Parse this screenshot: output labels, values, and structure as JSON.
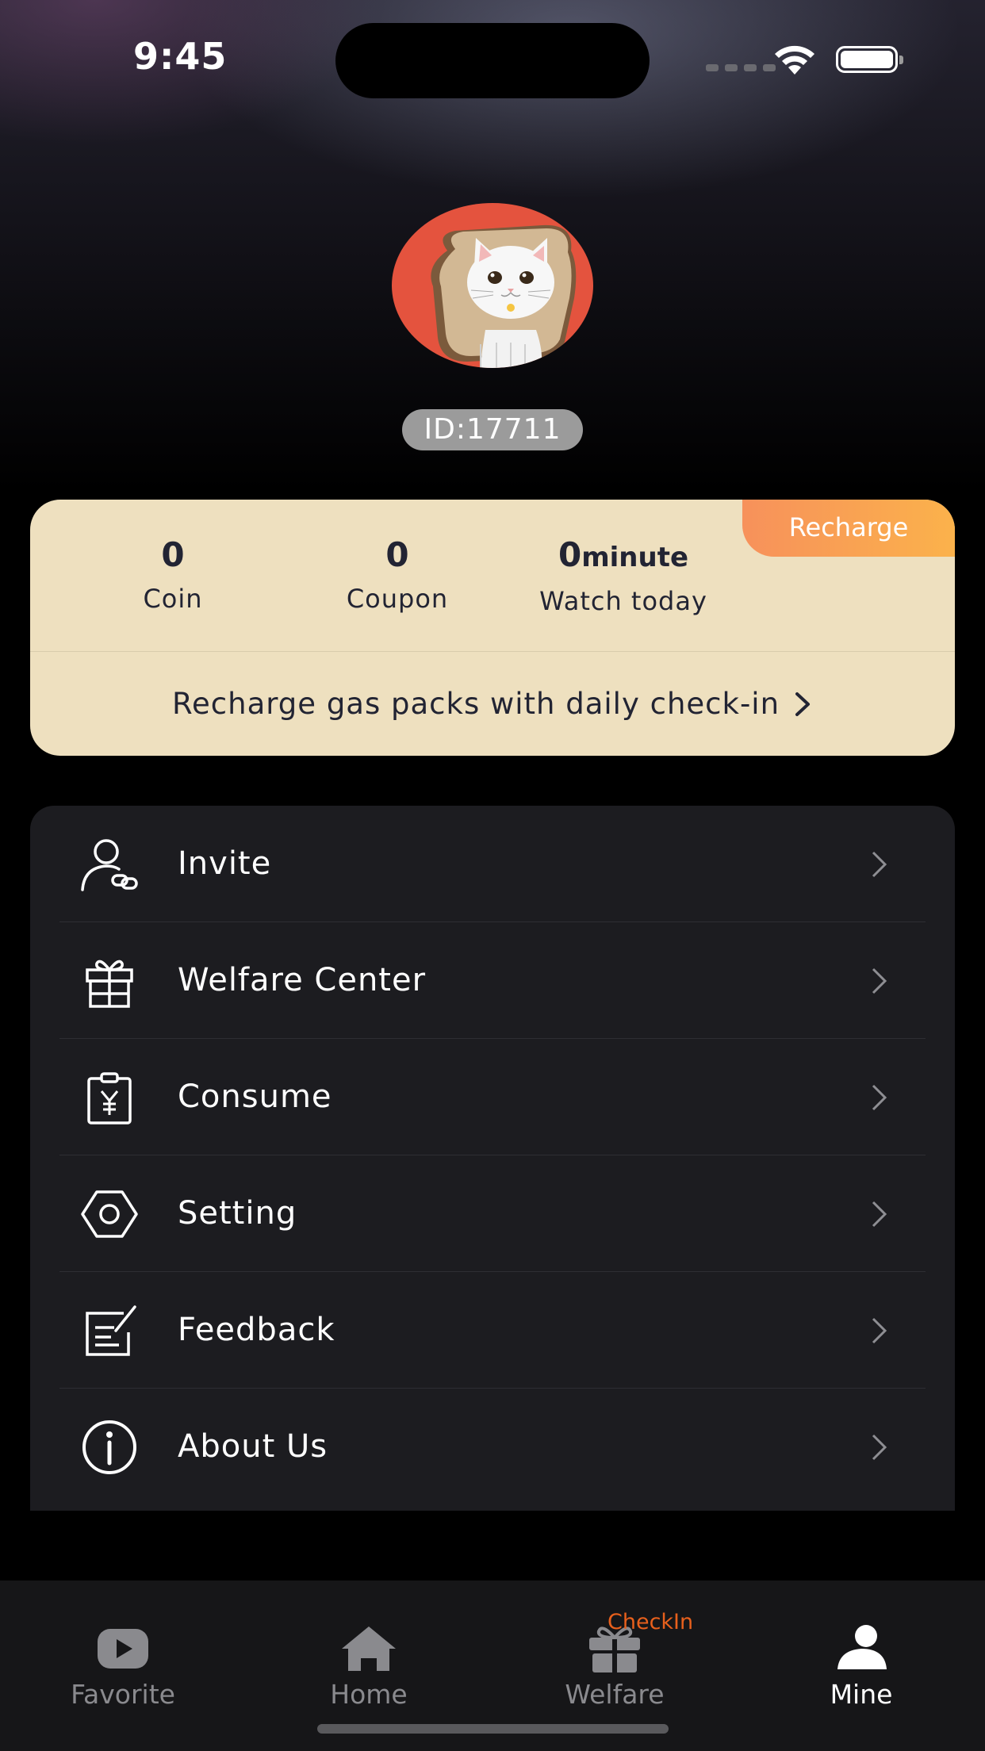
{
  "status_bar": {
    "time": "9:45"
  },
  "profile": {
    "id_label": "ID:17711"
  },
  "stats_card": {
    "recharge_label": "Recharge",
    "coin": {
      "value": "0",
      "label": "Coin"
    },
    "coupon": {
      "value": "0",
      "label": "Coupon"
    },
    "watch": {
      "value": "0",
      "unit": "minute",
      "label": "Watch today"
    },
    "checkin_text": "Recharge gas packs with daily check-in"
  },
  "menu": {
    "items": [
      {
        "label": "Invite",
        "icon": "invite-icon"
      },
      {
        "label": "Welfare Center",
        "icon": "gift-icon"
      },
      {
        "label": "Consume",
        "icon": "yen-receipt-icon"
      },
      {
        "label": "Setting",
        "icon": "gear-icon"
      },
      {
        "label": "Feedback",
        "icon": "edit-note-icon"
      },
      {
        "label": "About Us",
        "icon": "info-icon"
      }
    ]
  },
  "tabbar": {
    "tabs": [
      {
        "label": "Favorite",
        "icon": "play-icon"
      },
      {
        "label": "Home",
        "icon": "home-icon"
      },
      {
        "label": "Welfare",
        "icon": "gift-icon"
      },
      {
        "label": "Mine",
        "icon": "person-icon"
      }
    ],
    "active_tab": "Mine",
    "checkin_badge": "CheckIn"
  },
  "colors": {
    "card_bg": "#eee0bf",
    "recharge_gradient_start": "#f7915b",
    "recharge_gradient_end": "#fbb24b",
    "menu_bg": "#1c1c20",
    "checkin_badge": "#e8601c"
  }
}
